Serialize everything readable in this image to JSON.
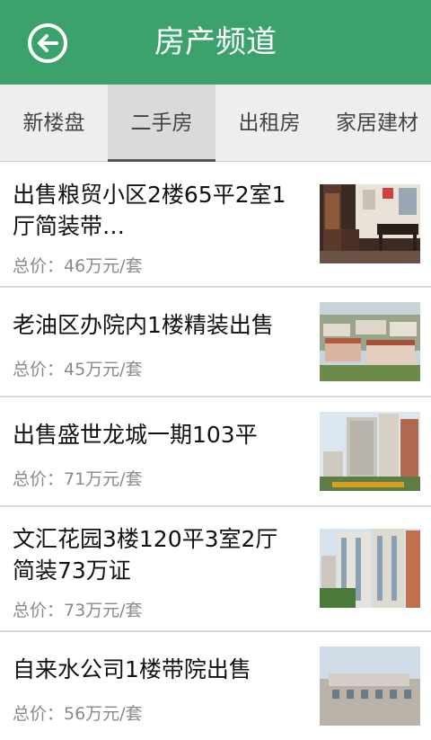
{
  "header": {
    "title": "房产频道",
    "back_icon": "back-arrow-circle-icon",
    "color": "#3aa26a"
  },
  "tabs": [
    {
      "label": "新楼盘",
      "active": false
    },
    {
      "label": "二手房",
      "active": true
    },
    {
      "label": "出租房",
      "active": false
    },
    {
      "label": "家居建材",
      "active": false
    }
  ],
  "listings": [
    {
      "title": "出售粮贸小区2楼65平2室1厅简装带…",
      "price": "总价：46万元/套"
    },
    {
      "title": "老油区办院内1楼精装出售",
      "price": "总价：45万元/套"
    },
    {
      "title": "出售盛世龙城一期103平",
      "price": "总价：71万元/套"
    },
    {
      "title": "文汇花园3楼120平3室2厅简装73万证",
      "price": "总价：73万元/套"
    },
    {
      "title": "自来水公司1楼带院出售",
      "price": "总价：56万元/套"
    }
  ]
}
